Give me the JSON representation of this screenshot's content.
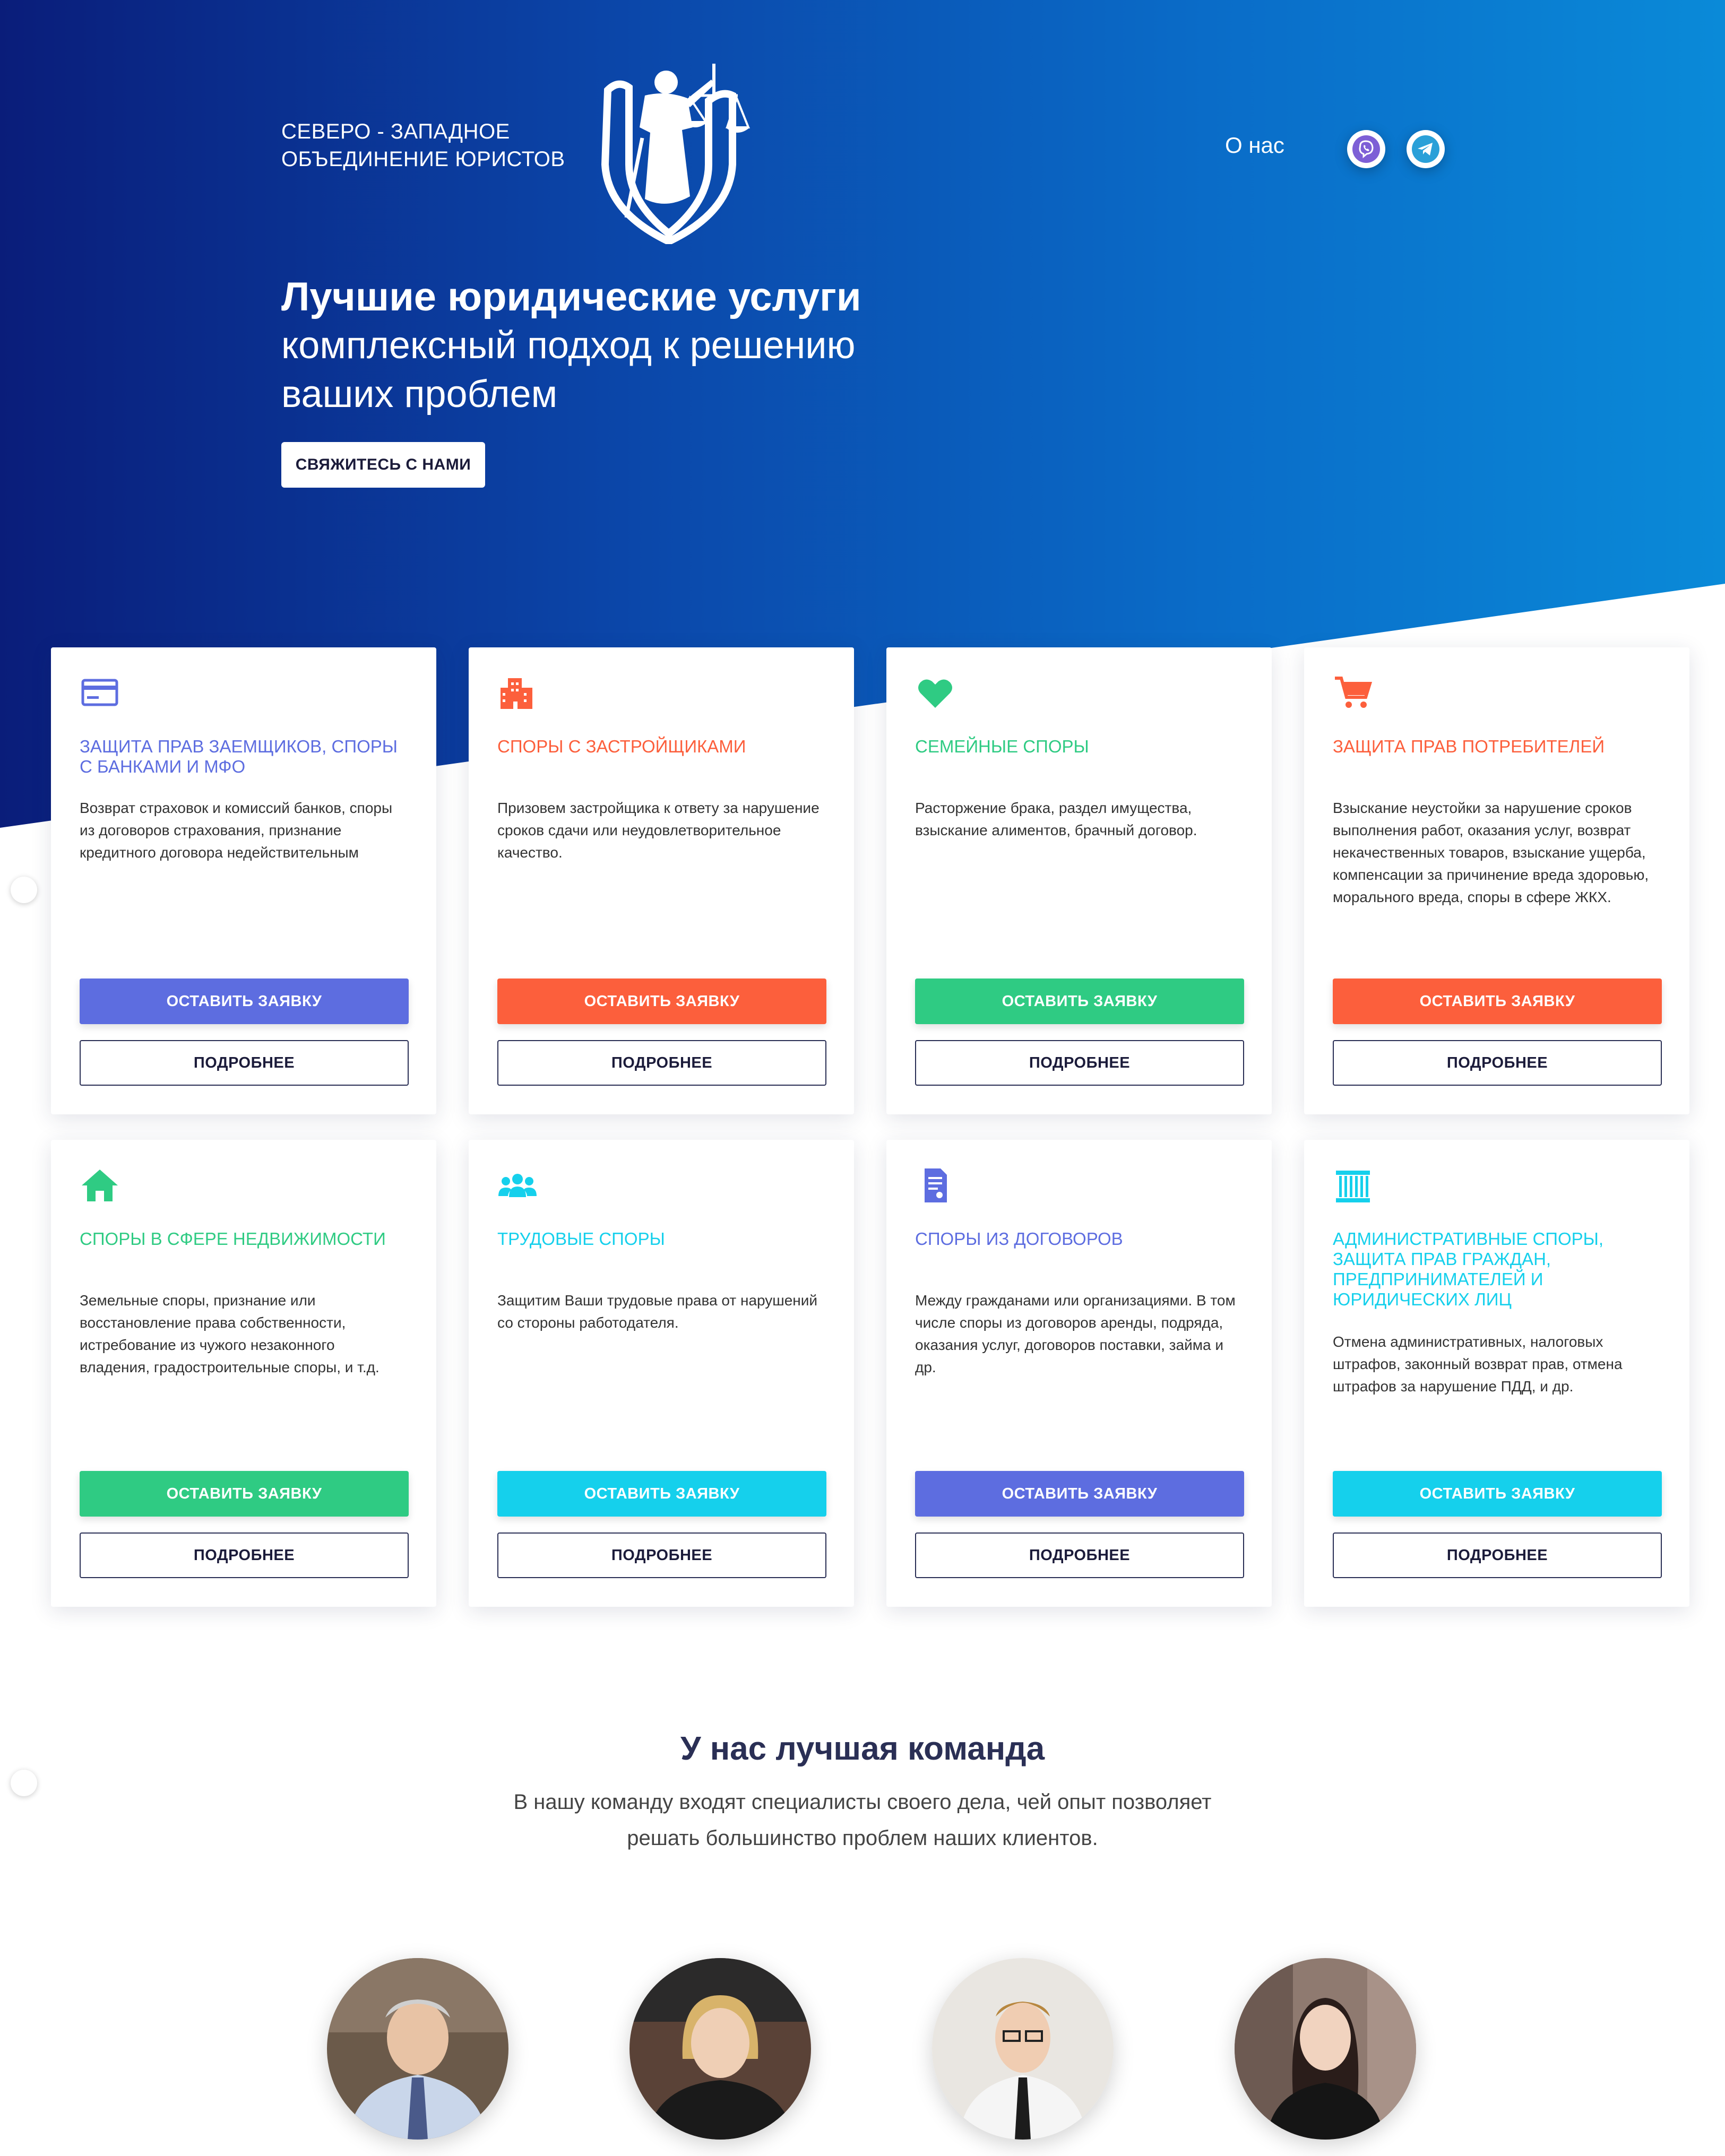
{
  "brand": {
    "line1": "СЕВЕРО - ЗАПАДНОЕ",
    "line2": "ОБЪЕДИНЕНИЕ ЮРИСТОВ",
    "logo_icon": "lady-justice-shield-logo"
  },
  "nav": {
    "about": "О нас",
    "viber_icon": "viber-icon",
    "telegram_icon": "telegram-icon"
  },
  "hero": {
    "title": "Лучшие юридические услуги",
    "subtitle": "комплексный подход к решению ваших проблем",
    "cta": "СВЯЖИТЕСЬ С НАМИ"
  },
  "colors": {
    "blue": "#5d6de0",
    "orange": "#fc5f3c",
    "green": "#2fcb83",
    "cyan": "#15d0ec"
  },
  "services": [
    {
      "icon": "credit-card-icon",
      "title": "ЗАЩИТА ПРАВ ЗАЕМЩИКОВ, СПОРЫ С БАНКАМИ И МФО",
      "desc": "Возврат страховок и комиссий банков, споры из договоров страхования, признание кредитного договора недействительным",
      "color": "#5d6de0",
      "apply": "ОСТАВИТЬ ЗАЯВКУ",
      "more": "ПОДРОБНЕЕ"
    },
    {
      "icon": "building-icon",
      "title": "СПОРЫ С ЗАСТРОЙЩИКАМИ",
      "desc": "Призовем застройщика к ответу за нарушение сроков сдачи или неудовлетворительное качество.",
      "color": "#fc5f3c",
      "apply": "ОСТАВИТЬ ЗАЯВКУ",
      "more": "ПОДРОБНЕЕ"
    },
    {
      "icon": "heart-icon",
      "title": "СЕМЕЙНЫЕ СПОРЫ",
      "desc": "Расторжение брака, раздел имущества, взыскание алиментов, брачный договор.",
      "color": "#2fcb83",
      "apply": "ОСТАВИТЬ ЗАЯВКУ",
      "more": "ПОДРОБНЕЕ"
    },
    {
      "icon": "shopping-cart-icon",
      "title": "ЗАЩИТА ПРАВ ПОТРЕБИТЕЛЕЙ",
      "desc": "Взыскание неустойки за нарушение сроков выполнения работ, оказания услуг, возврат некачественных товаров, взыскание ущерба, компенсации за причинение вреда здоровью, морального вреда, споры в сфере ЖКХ.",
      "color": "#fc5f3c",
      "apply": "ОСТАВИТЬ ЗАЯВКУ",
      "more": "ПОДРОБНЕЕ"
    },
    {
      "icon": "house-icon",
      "title": "СПОРЫ В СФЕРЕ НЕДВИЖИМОСТИ",
      "desc": "Земельные споры, признание или восстановление права собственности, истребование из чужого незаконного владения, градостроительные споры, и т.д.",
      "color": "#2fcb83",
      "apply": "ОСТАВИТЬ ЗАЯВКУ",
      "more": "ПОДРОБНЕЕ"
    },
    {
      "icon": "users-group-icon",
      "title": "ТРУДОВЫЕ СПОРЫ",
      "desc": "Защитим Ваши трудовые права от нарушений со стороны работодателя.",
      "color": "#15d0ec",
      "apply": "ОСТАВИТЬ ЗАЯВКУ",
      "more": "ПОДРОБНЕЕ"
    },
    {
      "icon": "contract-document-icon",
      "title": "СПОРЫ ИЗ ДОГОВОРОВ",
      "desc": "Между гражданами или организациями. В том числе споры из договоров аренды, подряда, оказания услуг, договоров поставки, займа и др.",
      "color": "#5d6de0",
      "apply": "ОСТАВИТЬ ЗАЯВКУ",
      "more": "ПОДРОБНЕЕ"
    },
    {
      "icon": "courthouse-icon",
      "title": "АДМИНИСТРАТИВНЫЕ СПОРЫ, ЗАЩИТА ПРАВ ГРАЖДАН, ПРЕДПРИНИМАТЕЛЕЙ И ЮРИДИЧЕСКИХ ЛИЦ",
      "desc": "Отмена административных, налоговых штрафов, законный возврат прав, отмена штрафов за нарушение ПДД, и др.",
      "color": "#15d0ec",
      "apply": "ОСТАВИТЬ ЗАЯВКУ",
      "more": "ПОДРОБНЕЕ"
    }
  ],
  "team": {
    "title": "У нас лучшая команда",
    "subtitle": "В нашу команду входят специалисты своего дела, чей опыт позволяет решать большинство проблем наших клиентов."
  }
}
